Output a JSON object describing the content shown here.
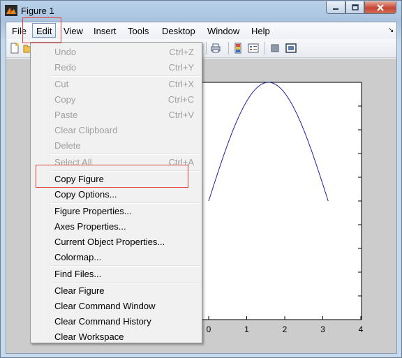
{
  "window": {
    "title": "Figure 1",
    "controls": {
      "minimize": "minimize",
      "maximize": "maximize",
      "close": "close"
    }
  },
  "menubar": {
    "items": [
      "File",
      "Edit",
      "View",
      "Insert",
      "Tools",
      "Desktop",
      "Window",
      "Help"
    ],
    "active": "Edit"
  },
  "edit_menu": {
    "items": [
      {
        "label": "Undo",
        "shortcut": "Ctrl+Z",
        "enabled": false
      },
      {
        "label": "Redo",
        "shortcut": "Ctrl+Y",
        "enabled": false
      },
      {
        "label": "Cut",
        "shortcut": "Ctrl+X",
        "enabled": false
      },
      {
        "label": "Copy",
        "shortcut": "Ctrl+C",
        "enabled": false
      },
      {
        "label": "Paste",
        "shortcut": "Ctrl+V",
        "enabled": false
      },
      {
        "label": "Clear Clipboard",
        "shortcut": "",
        "enabled": false
      },
      {
        "label": "Delete",
        "shortcut": "",
        "enabled": false
      },
      {
        "label": "Select All",
        "shortcut": "Ctrl+A",
        "enabled": false
      },
      {
        "label": "Copy Figure",
        "shortcut": "",
        "enabled": true
      },
      {
        "label": "Copy Options...",
        "shortcut": "",
        "enabled": true
      },
      {
        "label": "Figure Properties...",
        "shortcut": "",
        "enabled": true
      },
      {
        "label": "Axes Properties...",
        "shortcut": "",
        "enabled": true
      },
      {
        "label": "Current Object Properties...",
        "shortcut": "",
        "enabled": true
      },
      {
        "label": "Colormap...",
        "shortcut": "",
        "enabled": true
      },
      {
        "label": "Find Files...",
        "shortcut": "",
        "enabled": true
      },
      {
        "label": "Clear Figure",
        "shortcut": "",
        "enabled": true
      },
      {
        "label": "Clear Command Window",
        "shortcut": "",
        "enabled": true
      },
      {
        "label": "Clear Command History",
        "shortcut": "",
        "enabled": true
      },
      {
        "label": "Clear Workspace",
        "shortcut": "",
        "enabled": true
      }
    ]
  },
  "plot": {
    "x_tick_labels": [
      "0",
      "1",
      "2",
      "3",
      "4"
    ],
    "line_color": "#1f1f9e",
    "curve": "sin(x)",
    "x_range": [
      0,
      3.1416
    ]
  },
  "icons": {
    "app": "matlab-figure-icon",
    "toolbar": [
      "new-figure-icon",
      "open-file-icon",
      "print-icon",
      "colorbar-icon",
      "legend-icon",
      "hide-plot-tools-icon",
      "show-plot-tools-icon"
    ]
  },
  "colors": {
    "highlight_box": "#e5403a",
    "menu_background": "#f1f1f1",
    "figure_background": "#cccccc",
    "disabled_text": "#a0a0a0"
  }
}
